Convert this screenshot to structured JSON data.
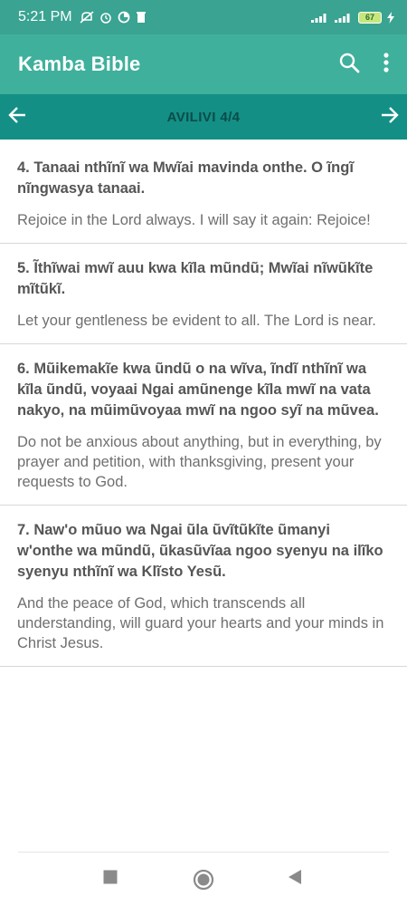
{
  "status": {
    "time": "5:21 PM",
    "battery": "67"
  },
  "app": {
    "title": "Kamba Bible",
    "icons": {
      "search": "search-icon",
      "menu": "more-vert-icon"
    }
  },
  "nav": {
    "title": "AVILIVI 4/4",
    "prev_icon": "arrow-left-icon",
    "next_icon": "arrow-right-icon"
  },
  "verses": [
    {
      "kamba": "4. Tanaai nthĩnĩ wa Mwĩai mavinda onthe. O ĩngĩ nĩngwasya tanaai.",
      "english": "Rejoice in the Lord always. I will say it again: Rejoice!"
    },
    {
      "kamba": "5. Ĩthĩwai mwĩ auu kwa kĩla mũndũ; Mwĩai nĩwũkĩte mĩtũkĩ.",
      "english": "Let your gentleness be evident to all. The Lord is near."
    },
    {
      "kamba": "6. Mũikemakĩe kwa ũndũ o na wĩva, ĩndĩ nthĩnĩ wa kĩla ũndũ, voyaai Ngai amũnenge kĩla mwĩ na vata nakyo, na mũimũvoyaa mwĩ na ngoo syĩ na mũvea.",
      "english": "Do not be anxious about anything, but in everything, by prayer and petition, with thanksgiving, present your requests to God."
    },
    {
      "kamba": "7. Naw'o mũuo wa Ngai ũla ũvĩtũkĩte ũmanyi w'onthe wa mũndũ, ũkasũvĩaa ngoo syenyu na ilĩko syenyu nthĩnĩ wa Klĩsto Yesũ.",
      "english": "And the peace of God, which transcends all understanding, will guard your hearts and your minds in Christ Jesus."
    }
  ],
  "colors": {
    "status_bar": "#3aa392",
    "app_bar": "#3fb09c",
    "nav_bar": "#138f86"
  }
}
